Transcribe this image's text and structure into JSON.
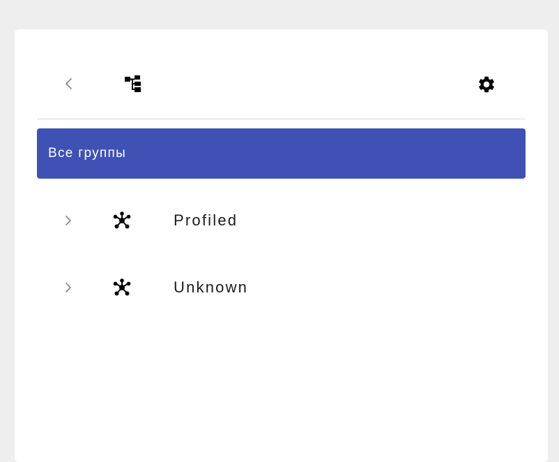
{
  "toolbar": {
    "back_icon": "chevron-left-icon",
    "tree_icon": "tree-structure-icon",
    "settings_icon": "gear-icon"
  },
  "all_groups": {
    "label": "Все группы",
    "background": "#3f51b5",
    "selected": true
  },
  "groups": [
    {
      "label": "Profiled",
      "icon": "network-cluster-icon",
      "expand_icon": "chevron-right-icon"
    },
    {
      "label": "Unknown",
      "icon": "network-cluster-icon",
      "expand_icon": "chevron-right-icon"
    }
  ]
}
